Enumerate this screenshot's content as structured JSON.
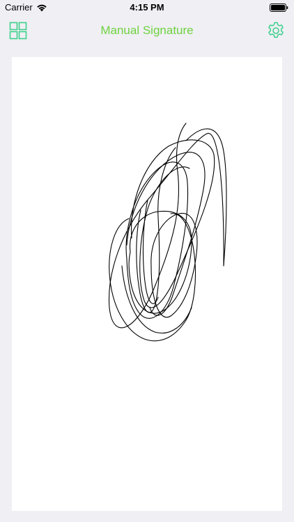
{
  "status_bar": {
    "carrier": "Carrier",
    "time": "4:15 PM",
    "wifi_icon": "wifi-icon",
    "battery_icon": "battery-icon"
  },
  "nav": {
    "title": "Manual Signature",
    "left_icon": "grid-icon",
    "right_icon": "gear-icon",
    "accent_color": "#6fd23e",
    "icon_color": "#3ecf8a"
  },
  "canvas": {
    "background": "#ffffff",
    "ink_color": "#000000"
  }
}
